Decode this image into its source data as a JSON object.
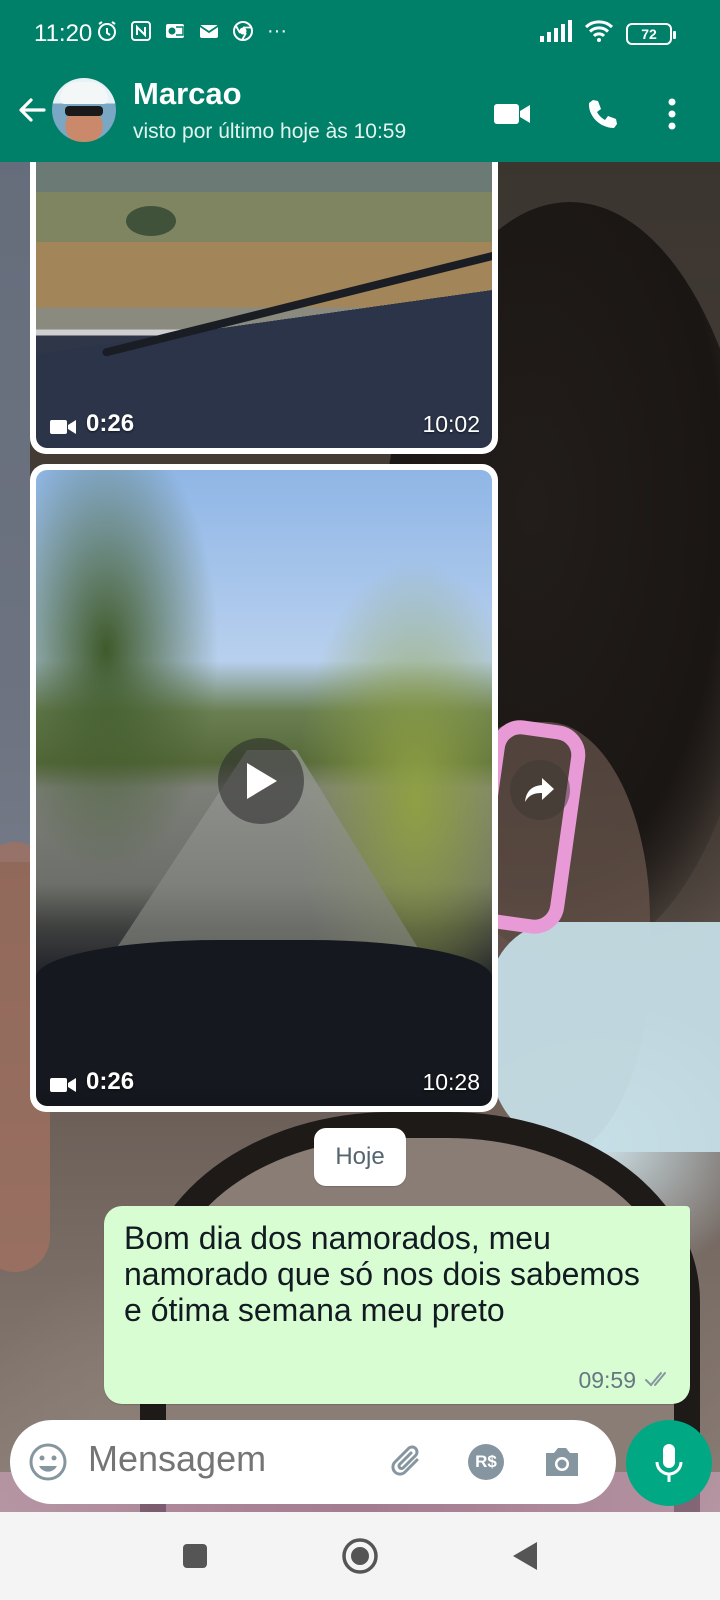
{
  "status_bar": {
    "time": "11:20",
    "battery": "72",
    "more": "···"
  },
  "header": {
    "contact_name": "Marcao",
    "last_seen": "visto por último hoje às 10:59",
    "icons": [
      "back-arrow-icon",
      "video-call-icon",
      "voice-call-icon",
      "more-vertical-icon"
    ],
    "color": "#008069"
  },
  "messages": [
    {
      "type": "video",
      "duration": "0:26",
      "time": "10:02"
    },
    {
      "type": "video",
      "duration": "0:26",
      "time": "10:28"
    }
  ],
  "date_divider": "Hoje",
  "outgoing": {
    "text": "Bom dia dos namorados, meu namorado que só nos dois sabemos e ótima semana meu preto",
    "time": "09:59",
    "status": "read",
    "bubble_color": "#d9fdd3"
  },
  "composer": {
    "placeholder": "Mensagem",
    "icons": [
      "emoji-icon",
      "attach-icon",
      "payment-icon",
      "camera-icon",
      "mic-icon"
    ],
    "payment_label": "R$",
    "accent": "#00a884"
  },
  "nav_bar": {
    "icons": [
      "recent-apps-icon",
      "home-icon",
      "back-icon"
    ]
  }
}
